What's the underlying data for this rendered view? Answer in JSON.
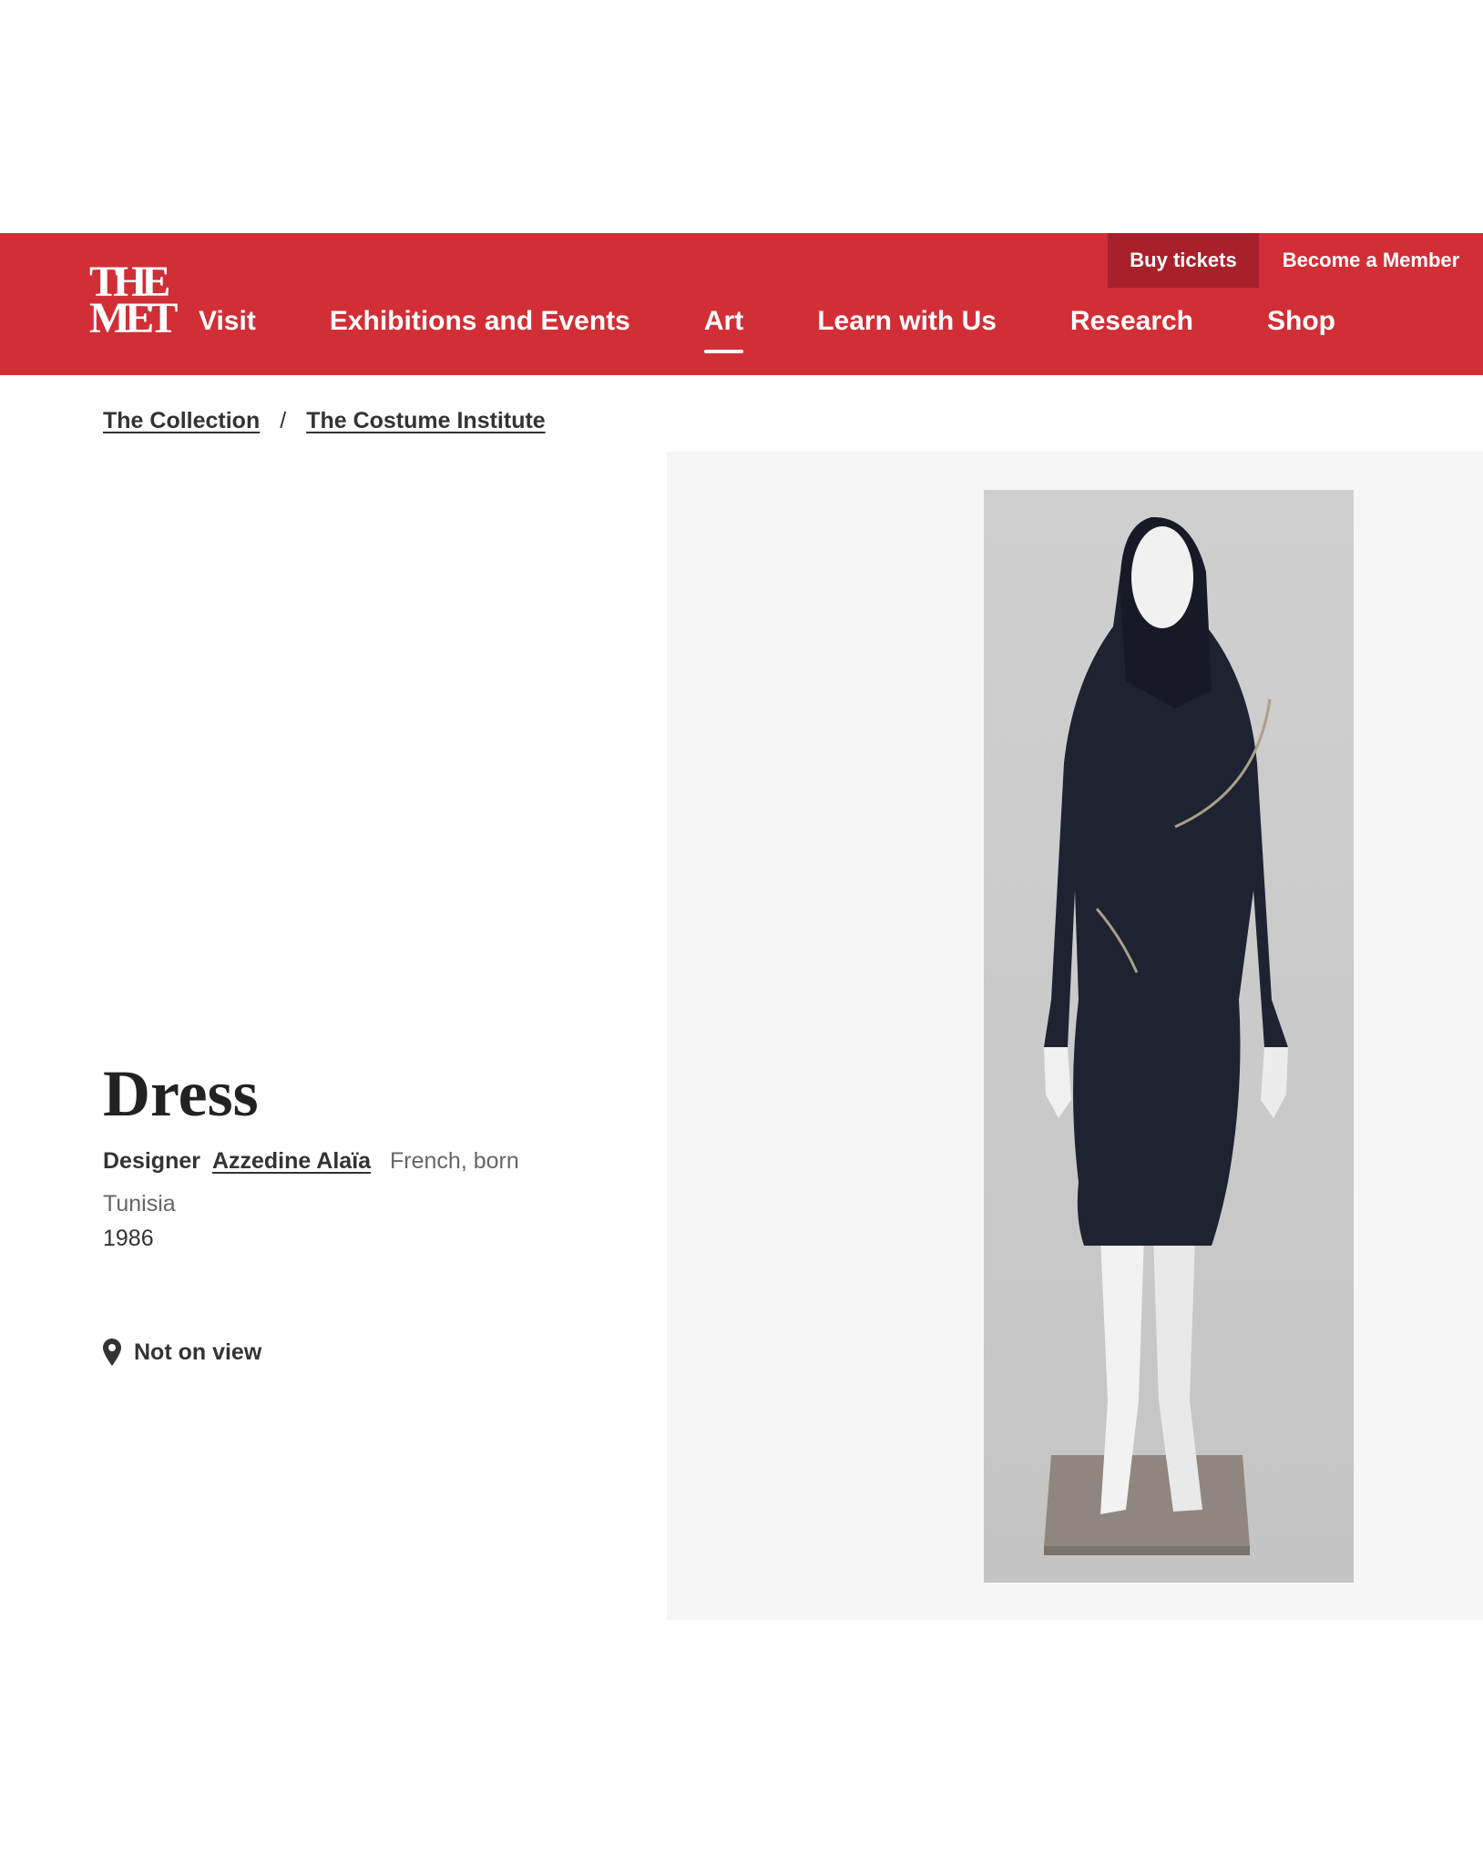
{
  "header": {
    "logo": {
      "line1": "THE",
      "line2": "MET"
    },
    "utility": {
      "buy_tickets": "Buy tickets",
      "become_member": "Become a Member"
    },
    "nav": [
      {
        "label": "Visit"
      },
      {
        "label": "Exhibitions and Events"
      },
      {
        "label": "Art",
        "active": true
      },
      {
        "label": "Learn with Us"
      },
      {
        "label": "Research"
      },
      {
        "label": "Shop"
      }
    ]
  },
  "breadcrumb": {
    "item1": "The Collection",
    "separator": "/",
    "item2": "The Costume Institute"
  },
  "artwork": {
    "title": "Dress",
    "role": "Designer",
    "artist": "Azzedine Alaïa",
    "nationality": "French, born Tunisia",
    "date": "1986",
    "location_status": "Not on view"
  },
  "colors": {
    "brand_red": "#d22e36",
    "buy_tickets_bg": "#a8212a",
    "image_panel_bg": "#f6f6f6"
  },
  "icons": {
    "location": "map-pin-icon"
  }
}
